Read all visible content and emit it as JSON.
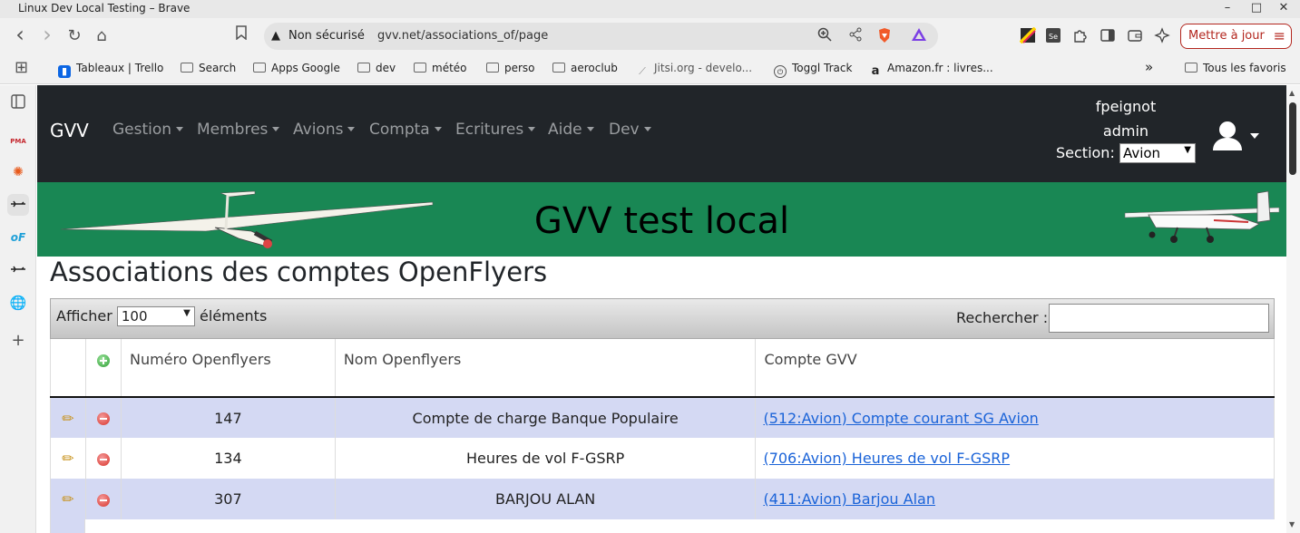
{
  "window": {
    "title": "Linux Dev Local Testing – Brave",
    "minimize": "–",
    "maximize": "□",
    "close": "✕"
  },
  "toolbar": {
    "back_icon": "‹",
    "forward_icon": "›",
    "reload_icon": "↻",
    "home_icon": "⌂",
    "bookmark_icon": "🔖",
    "security_warning": "▲",
    "security_text": "Non sécurisé",
    "url": "gvv.net/associations_of/page",
    "update_label": "Mettre à jour",
    "menu_icon": "≡"
  },
  "bookmarks": {
    "apps_icon": "⊞",
    "items": [
      "Tableaux | Trello",
      "Search",
      "Apps Google",
      "dev",
      "météo",
      "perso",
      "aeroclub",
      "Jitsi.org - develo...",
      "Toggl Track",
      "Amazon.fr : livres..."
    ],
    "overflow": "»",
    "all_favorites": "Tous les favoris"
  },
  "app": {
    "brand": "GVV",
    "menus": [
      "Gestion",
      "Membres",
      "Avions",
      "Compta",
      "Ecritures",
      "Aide",
      "Dev"
    ],
    "user": "fpeignot",
    "role": "admin",
    "section_label": "Section:",
    "section_value": "Avion",
    "banner_title": "GVV test local"
  },
  "page": {
    "title": "Associations des comptes OpenFlyers",
    "length_prefix": "Afficher",
    "length_value": "100",
    "length_suffix": "éléments",
    "search_label": "Rechercher :",
    "search_value": ""
  },
  "table": {
    "columns": [
      "",
      "",
      "Numéro Openflyers",
      "Nom Openflyers",
      "Compte GVV"
    ],
    "rows": [
      {
        "numero": "147",
        "nom": "Compte de charge Banque Populaire",
        "compte": "(512:Avion) Compte courant SG Avion"
      },
      {
        "numero": "134",
        "nom": "Heures de vol F-GSRP",
        "compte": "(706:Avion) Heures de vol F-GSRP"
      },
      {
        "numero": "307",
        "nom": "BARJOU ALAN",
        "compte": "(411:Avion) Barjou Alan"
      }
    ]
  },
  "colors": {
    "navbar": "#212529",
    "banner": "#198754",
    "row_odd": "#d4d9f3",
    "link": "#1a63d8",
    "update_button": "#b3261e"
  }
}
